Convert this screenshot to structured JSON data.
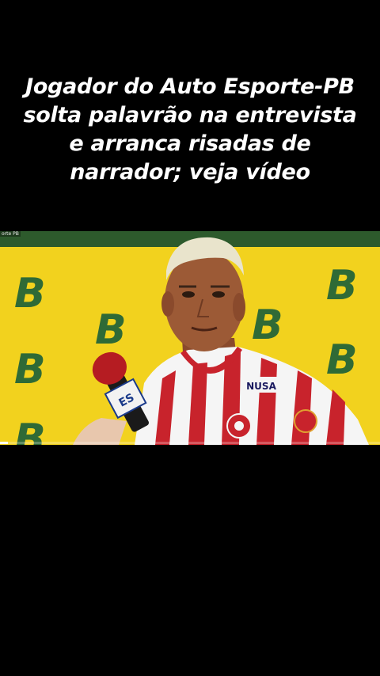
{
  "headline": "Jogador do Auto Esporte-PB solta palavrão na entrevista e arranca risadas de narrador; veja vídeo",
  "video": {
    "corner_label": "orte PB",
    "backdrop_letter": "B",
    "microphone_label": "ES",
    "jersey_text": "NUSA",
    "progress": 0.02
  },
  "colors": {
    "backdrop_yellow": "#f2d21e",
    "backdrop_green": "#2f6a36",
    "jersey_red": "#c8232c",
    "jersey_white": "#f5f5f5"
  }
}
